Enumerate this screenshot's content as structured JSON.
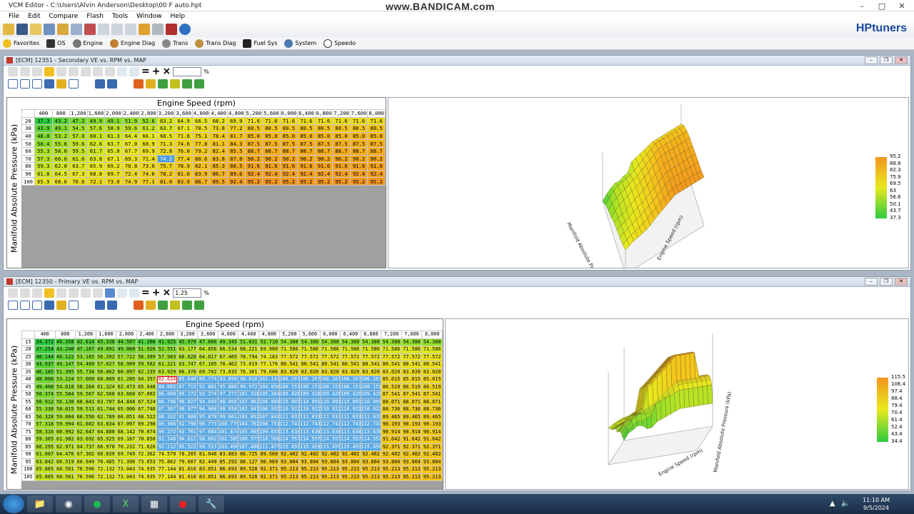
{
  "app": {
    "title": "VCM Editor - C:\\Users\\Alvin Anderson\\Desktop\\00 F auto.hpt",
    "watermark": "www.BANDICAM.com",
    "logo": "HPtuners"
  },
  "menu": [
    "File",
    "Edit",
    "Compare",
    "Flash",
    "Tools",
    "Window",
    "Help"
  ],
  "nav": [
    "Favorites",
    "OS",
    "Engine",
    "Engine Diag",
    "Trans",
    "Trans Diag",
    "Fuel Sys",
    "System",
    "Speedo"
  ],
  "winA": {
    "title": "[ECM] 12351 - Secondary VE vs. RPM vs. MAP",
    "input_value": "",
    "percent": "%",
    "x_title": "Engine Speed (rpm)",
    "y_title": "Manifold Absolute Pressure (kPa)",
    "legend": [
      "95.2",
      "88.8",
      "82.3",
      "75.9",
      "69.5",
      "63",
      "56.6",
      "50.1",
      "43.7",
      "37.3"
    ],
    "plot_labels": [
      "Engine Speed (rpm)",
      "Manifold Absolute Pressure (kPa)"
    ]
  },
  "winB": {
    "title": "[ECM] 12350 - Primary VE vs. RPM vs. MAP",
    "input_value": "1.25",
    "percent": "%",
    "x_title": "Engine Speed (rpm)",
    "y_title": "Manifold Absolute Pressure (kPa)",
    "legend": [
      "115.5",
      "106.4",
      "97.4",
      "88.4",
      "79.4",
      "70.4",
      "61.4",
      "52.4",
      "43.4",
      "34.4"
    ],
    "plot_labels": [
      "Engine Speed (rpm)",
      "Manifold Absolute Pressure (kPa)"
    ]
  },
  "tableA": {
    "cols": [
      "400",
      "800",
      "1,200",
      "1,600",
      "2,000",
      "2,400",
      "2,800",
      "3,200",
      "3,600",
      "4,000",
      "4,400",
      "4,800",
      "5,200",
      "5,600",
      "6,000",
      "6,400",
      "6,800",
      "7,200",
      "7,600",
      "8,000"
    ],
    "rows": [
      "20",
      "30",
      "40",
      "50",
      "60",
      "70",
      "80",
      "90",
      "100"
    ],
    "values": [
      [
        "37.3",
        "43.2",
        "47.2",
        "49.9",
        "49.1",
        "51.9",
        "52.6",
        "63.2",
        "64.9",
        "66.5",
        "68.2",
        "69.9",
        "71.6",
        "71.6",
        "71.6",
        "71.6",
        "71.6",
        "71.6",
        "71.6",
        "71.6"
      ],
      [
        "43.9",
        "49.1",
        "54.5",
        "57.6",
        "58.9",
        "59.6",
        "61.2",
        "63.7",
        "67.1",
        "70.5",
        "73.8",
        "77.2",
        "80.5",
        "80.5",
        "80.5",
        "80.5",
        "80.5",
        "80.5",
        "80.5",
        "80.5"
      ],
      [
        "48.0",
        "53.2",
        "57.0",
        "60.1",
        "61.3",
        "64.4",
        "66.1",
        "68.5",
        "71.8",
        "75.1",
        "78.4",
        "81.7",
        "85.0",
        "85.0",
        "85.0",
        "85.0",
        "85.0",
        "85.0",
        "85.0",
        "85.0"
      ],
      [
        "50.4",
        "55.6",
        "59.6",
        "62.6",
        "63.7",
        "67.0",
        "68.9",
        "71.3",
        "74.6",
        "77.8",
        "81.1",
        "84.3",
        "87.5",
        "87.5",
        "87.5",
        "87.5",
        "87.5",
        "87.5",
        "87.5",
        "87.5"
      ],
      [
        "55.3",
        "58.0",
        "59.5",
        "61.7",
        "65.0",
        "67.7",
        "69.9",
        "72.8",
        "76.0",
        "79.2",
        "82.4",
        "85.5",
        "88.7",
        "88.7",
        "88.7",
        "88.7",
        "88.7",
        "88.7",
        "88.7",
        "88.7"
      ],
      [
        "57.3",
        "60.0",
        "61.6",
        "63.8",
        "67.1",
        "69.3",
        "71.4",
        "74.2",
        "77.4",
        "80.6",
        "83.8",
        "87.0",
        "90.2",
        "90.2",
        "90.2",
        "90.2",
        "90.2",
        "90.2",
        "90.2",
        "90.2"
      ],
      [
        "59.3",
        "62.0",
        "63.7",
        "65.9",
        "69.2",
        "70.8",
        "73.0",
        "75.7",
        "78.9",
        "82.1",
        "85.3",
        "88.5",
        "91.6",
        "91.6",
        "91.6",
        "91.6",
        "91.6",
        "91.6",
        "91.6",
        "91.6"
      ],
      [
        "61.8",
        "64.5",
        "67.3",
        "68.8",
        "69.7",
        "72.4",
        "74.6",
        "78.2",
        "81.0",
        "83.9",
        "86.7",
        "89.6",
        "92.4",
        "92.4",
        "92.4",
        "92.4",
        "92.4",
        "92.4",
        "92.4",
        "92.4"
      ],
      [
        "65.9",
        "68.6",
        "70.6",
        "72.1",
        "73.0",
        "74.9",
        "77.1",
        "81.0",
        "83.9",
        "86.7",
        "89.5",
        "92.4",
        "95.2",
        "95.2",
        "95.2",
        "95.2",
        "95.2",
        "95.2",
        "95.2",
        "95.2"
      ]
    ],
    "selected": [
      5,
      7
    ]
  },
  "tableB": {
    "cols": [
      "400",
      "800",
      "1,200",
      "1,600",
      "2,000",
      "2,400",
      "2,800",
      "3,200",
      "3,600",
      "4,000",
      "4,400",
      "4,800",
      "5,200",
      "5,600",
      "6,000",
      "6,400",
      "6,800",
      "7,200",
      "7,600",
      "8,000"
    ],
    "rows": [
      "15",
      "20",
      "25",
      "30",
      "35",
      "40",
      "45",
      "50",
      "55",
      "60",
      "65",
      "70",
      "75",
      "80",
      "85",
      "90",
      "95",
      "100",
      "105"
    ],
    "values": [
      [
        "34.372",
        "40.350",
        "42.614",
        "45.338",
        "44.507",
        "41.308",
        "41.925",
        "45.979",
        "47.666",
        "49.345",
        "51.031",
        "52.710",
        "54.388",
        "54.388",
        "54.388",
        "54.388",
        "54.388",
        "54.388",
        "54.388",
        "54.388"
      ],
      [
        "37.254",
        "43.240",
        "47.167",
        "49.891",
        "49.060",
        "51.926",
        "52.551",
        "63.177",
        "64.856",
        "66.534",
        "68.221",
        "69.900",
        "71.586",
        "71.586",
        "71.586",
        "71.586",
        "71.586",
        "71.586",
        "71.586",
        "71.586"
      ],
      [
        "40.144",
        "46.122",
        "53.185",
        "56.392",
        "57.722",
        "56.399",
        "57.983",
        "60.628",
        "64.017",
        "67.405",
        "70.794",
        "74.183",
        "77.572",
        "77.572",
        "77.572",
        "77.572",
        "77.572",
        "77.572",
        "77.572",
        "77.572"
      ],
      [
        "43.937",
        "49.147",
        "54.460",
        "57.627",
        "58.909",
        "59.582",
        "61.221",
        "63.747",
        "67.105",
        "70.462",
        "73.819",
        "77.176",
        "80.541",
        "80.541",
        "80.541",
        "80.541",
        "80.541",
        "80.541",
        "80.541",
        "80.541"
      ],
      [
        "46.185",
        "51.395",
        "55.734",
        "58.862",
        "60.097",
        "62.235",
        "63.929",
        "66.376",
        "69.702",
        "73.035",
        "76.361",
        "79.686",
        "83.020",
        "83.020",
        "83.020",
        "83.020",
        "83.020",
        "83.020",
        "83.020",
        "83.020"
      ],
      [
        "48.006",
        "53.224",
        "57.009",
        "60.089",
        "61.285",
        "64.357",
        "82.624",
        "85.640",
        "89.774",
        "93.899",
        "98.016",
        "102.141",
        "106.267",
        "106.267",
        "106.267",
        "106.267",
        "106.267",
        "85.015",
        "85.015",
        "85.015"
      ],
      [
        "49.408",
        "54.618",
        "58.284",
        "61.324",
        "62.473",
        "65.948",
        "84.682",
        "87.715",
        "91.801",
        "95.886",
        "99.972",
        "104.058",
        "108.151",
        "108.151",
        "108.151",
        "108.151",
        "108.151",
        "86.519",
        "86.519",
        "86.519"
      ],
      [
        "50.374",
        "55.584",
        "59.567",
        "62.560",
        "63.660",
        "67.002",
        "86.068",
        "89.172",
        "93.274",
        "97.272",
        "101.318",
        "105.364",
        "109.426",
        "109.426",
        "109.426",
        "109.426",
        "109.426",
        "87.541",
        "87.541",
        "87.541"
      ],
      [
        "50.912",
        "56.130",
        "60.841",
        "63.787",
        "64.848",
        "67.524",
        "86.796",
        "90.027",
        "94.049",
        "98.056",
        "102.062",
        "106.069",
        "110.091",
        "110.091",
        "110.091",
        "110.091",
        "110.091",
        "88.071",
        "88.071",
        "88.071"
      ],
      [
        "55.338",
        "58.015",
        "59.511",
        "61.744",
        "65.006",
        "67.746",
        "87.367",
        "90.977",
        "94.968",
        "98.950",
        "102.941",
        "106.932",
        "110.922",
        "110.922",
        "110.922",
        "110.922",
        "110.922",
        "88.736",
        "88.736",
        "88.736"
      ],
      [
        "56.328",
        "59.004",
        "60.556",
        "62.789",
        "66.051",
        "68.522",
        "88.332",
        "91.888",
        "95.878",
        "99.861",
        "103.852",
        "107.842",
        "111.833",
        "111.833",
        "111.833",
        "111.833",
        "111.833",
        "89.465",
        "89.465",
        "89.465"
      ],
      [
        "57.318",
        "59.994",
        "61.602",
        "63.834",
        "67.097",
        "69.298",
        "89.306",
        "92.790",
        "96.773",
        "100.779",
        "104.762",
        "108.753",
        "112.743",
        "112.743",
        "112.743",
        "112.743",
        "112.743",
        "90.193",
        "90.193",
        "90.193"
      ],
      [
        "58.316",
        "60.992",
        "62.647",
        "64.880",
        "68.142",
        "70.074",
        "90.272",
        "93.701",
        "97.684",
        "101.674",
        "105.665",
        "109.655",
        "113.638",
        "113.638",
        "113.638",
        "113.638",
        "113.638",
        "90.914",
        "90.914",
        "90.914"
      ],
      [
        "59.305",
        "61.982",
        "63.692",
        "65.925",
        "69.187",
        "70.850",
        "91.246",
        "94.611",
        "98.602",
        "102.585",
        "106.575",
        "110.566",
        "114.557",
        "114.557",
        "114.557",
        "114.557",
        "114.557",
        "91.642",
        "91.642",
        "91.642"
      ],
      [
        "60.295",
        "62.971",
        "64.737",
        "66.970",
        "70.232",
        "71.626",
        "92.212",
        "95.522",
        "99.513",
        "103.496",
        "107.486",
        "111.477",
        "115.459",
        "115.459",
        "115.459",
        "115.459",
        "115.459",
        "92.371",
        "92.371",
        "92.371"
      ],
      [
        "61.807",
        "64.476",
        "67.302",
        "68.839",
        "69.749",
        "72.362",
        "74.579",
        "78.205",
        "81.048",
        "83.883",
        "86.725",
        "89.560",
        "92.402",
        "92.402",
        "92.402",
        "92.402",
        "92.402",
        "92.402",
        "92.402",
        "92.402"
      ],
      [
        "63.842",
        "66.519",
        "68.949",
        "70.485",
        "71.396",
        "73.653",
        "75.862",
        "79.607",
        "82.449",
        "85.292",
        "88.127",
        "90.969",
        "93.804",
        "93.804",
        "93.804",
        "93.804",
        "93.804",
        "93.804",
        "93.804",
        "93.804"
      ],
      [
        "65.885",
        "68.561",
        "70.596",
        "72.132",
        "73.043",
        "74.935",
        "77.144",
        "81.016",
        "83.851",
        "86.693",
        "89.528",
        "92.371",
        "95.213",
        "95.213",
        "95.213",
        "95.213",
        "95.213",
        "95.213",
        "95.213",
        "95.213"
      ],
      [
        "65.885",
        "68.561",
        "70.596",
        "72.132",
        "73.043",
        "74.935",
        "77.144",
        "81.016",
        "83.851",
        "86.693",
        "89.528",
        "92.371",
        "95.213",
        "95.213",
        "95.213",
        "95.213",
        "95.213",
        "95.213",
        "95.213",
        "95.213"
      ]
    ],
    "mod_rows": [
      5,
      14
    ],
    "mod_cols": [
      6,
      16
    ],
    "red_cell": [
      5,
      6
    ]
  },
  "taskbar": {
    "time": "11:10 AM",
    "date": "9/5/2024"
  }
}
